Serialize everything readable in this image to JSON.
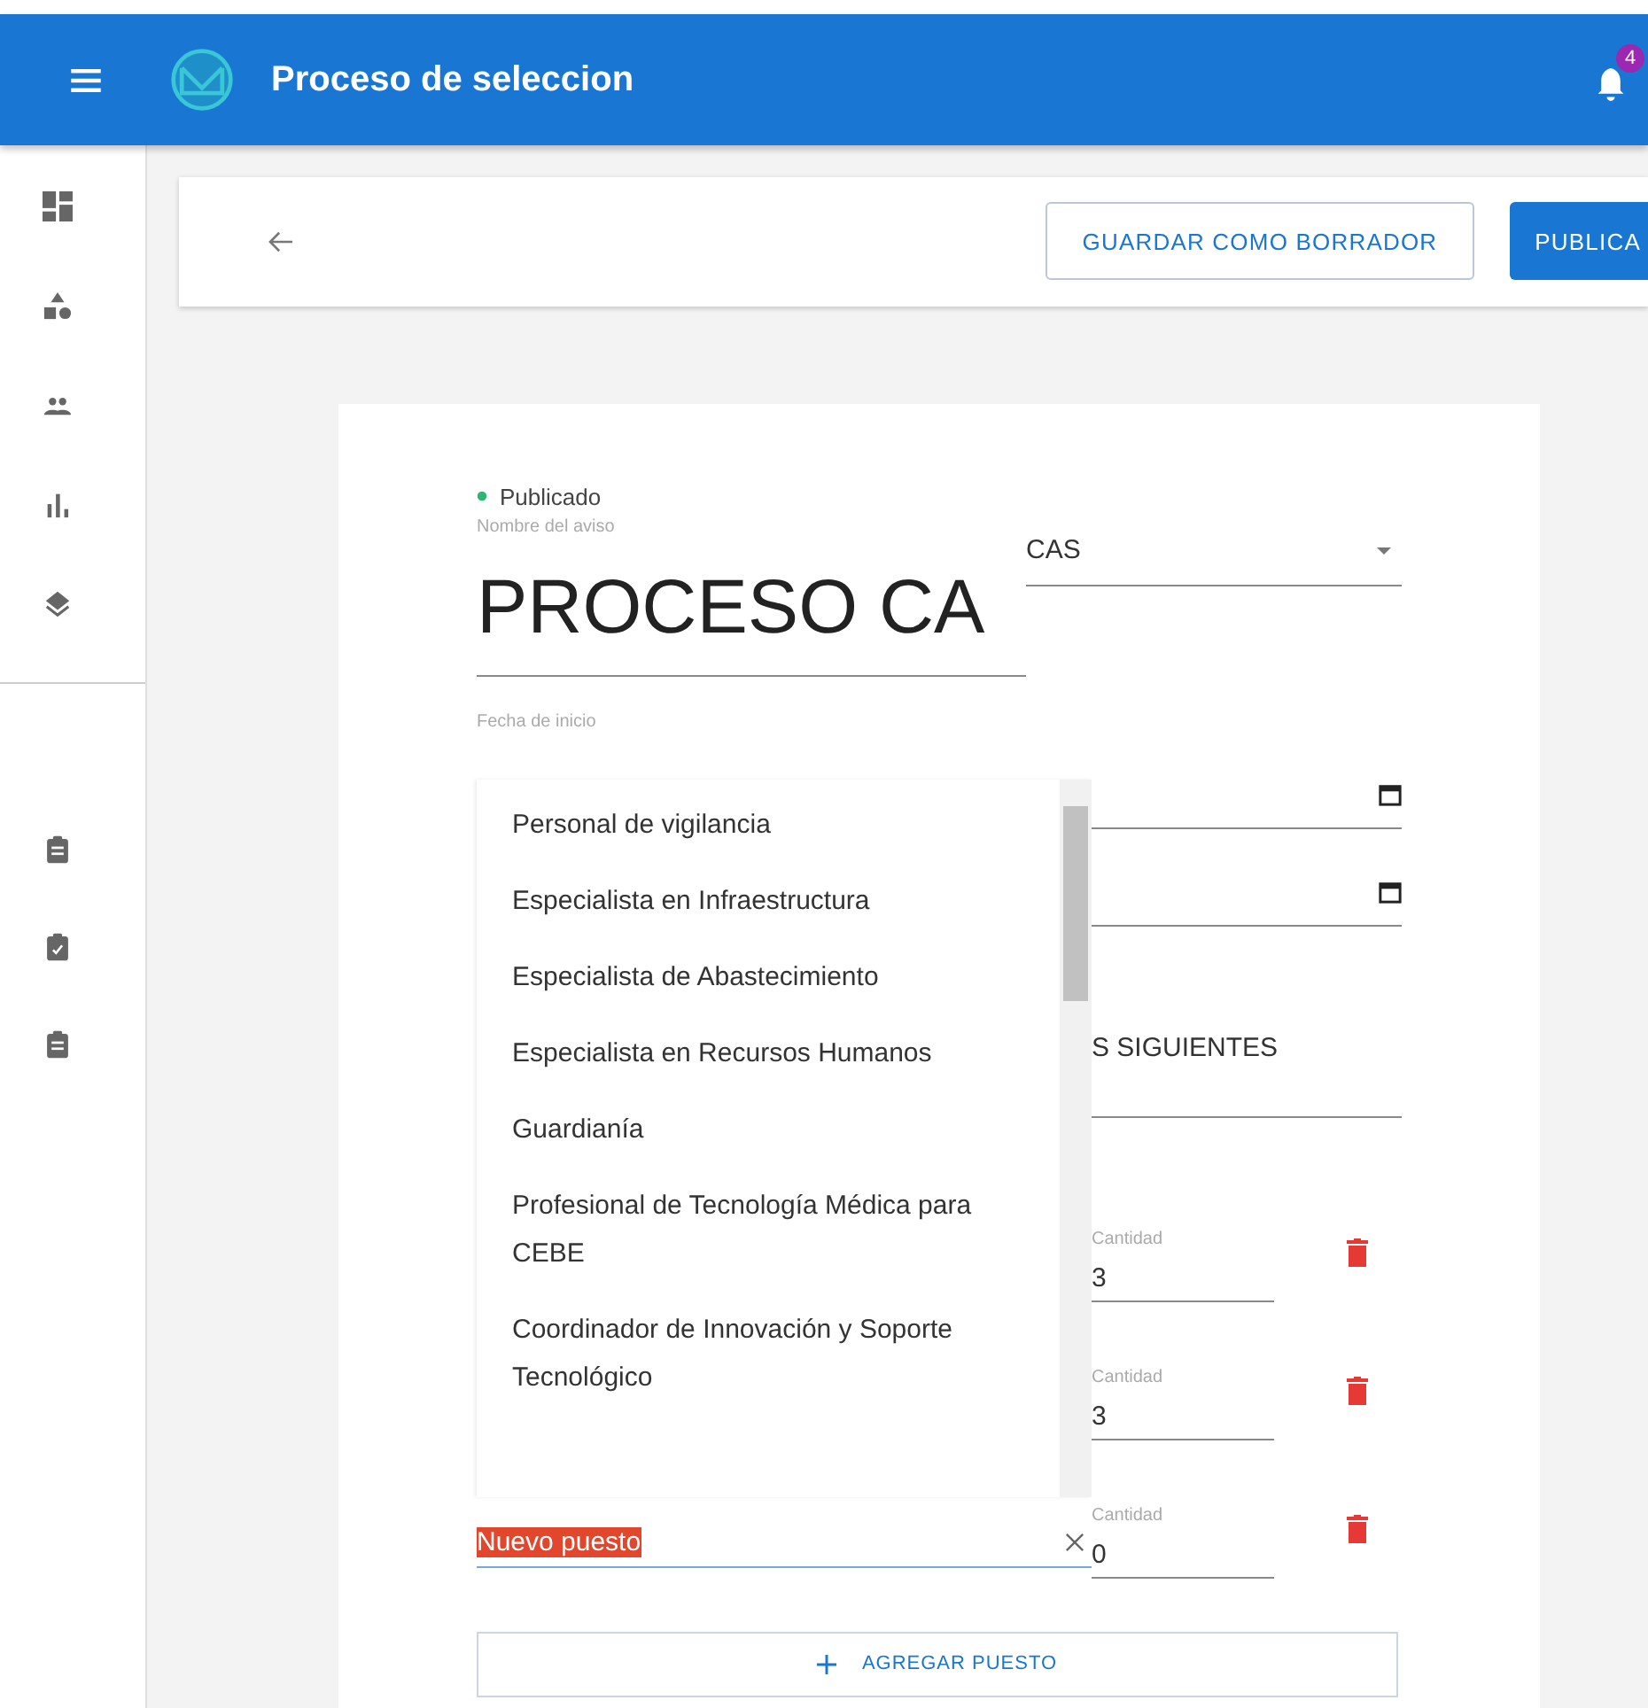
{
  "app_bar": {
    "title": "Proceso de seleccion",
    "notification_count": "4"
  },
  "toolbar": {
    "buttons": [
      {
        "label": "GUARDAR COMO BORRADOR",
        "kind": "outlined"
      },
      {
        "label": "PUBLICA",
        "kind": "filled"
      }
    ]
  },
  "form": {
    "status": "Publicado",
    "name_field": {
      "label": "Nombre del aviso",
      "value": "PROCESO CA"
    },
    "type_select": {
      "value": "CAS"
    },
    "start_date": {
      "label": "Fecha de inicio"
    },
    "select_2": {
      "value": "S SIGUIENTES"
    },
    "positions": [
      {
        "quantity_label": "Cantidad",
        "quantity": "3"
      },
      {
        "quantity_label": "Cantidad",
        "quantity": "3"
      },
      {
        "name": "Nuevo puesto",
        "name_selected": true,
        "quantity_label": "Cantidad",
        "quantity": "0"
      }
    ],
    "add_button": "AGREGAR PUESTO"
  },
  "dropdown": {
    "options": [
      "Personal de vigilancia",
      "Especialista en Infraestructura",
      "Especialista de Abastecimiento",
      "Especialista en Recursos Humanos",
      "Guardianía",
      "Profesional de Tecnología Médica para CEBE",
      "Coordinador de Innovación y Soporte Tecnológico"
    ]
  }
}
